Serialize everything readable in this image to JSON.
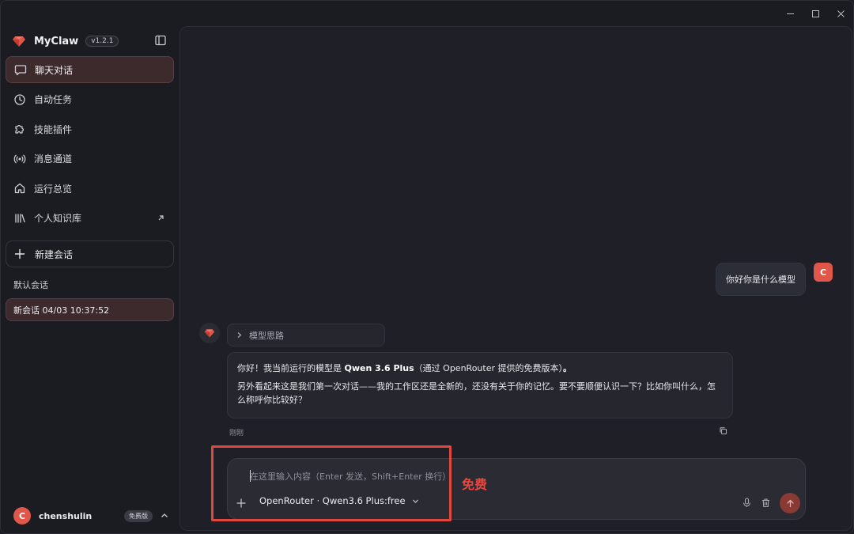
{
  "window": {
    "controls": [
      "minimize",
      "maximize",
      "close"
    ]
  },
  "sidebar": {
    "brand": {
      "name": "MyClaw",
      "version": "v1.2.1"
    },
    "nav": [
      {
        "label": "聊天对话",
        "icon": "chat-bubble-icon",
        "active": true
      },
      {
        "label": "自动任务",
        "icon": "clock-icon",
        "active": false
      },
      {
        "label": "技能插件",
        "icon": "puzzle-icon",
        "active": false
      },
      {
        "label": "消息通道",
        "icon": "broadcast-icon",
        "active": false
      },
      {
        "label": "运行总览",
        "icon": "home-icon",
        "active": false
      },
      {
        "label": "个人知识库",
        "icon": "library-icon",
        "active": false,
        "external": true
      }
    ],
    "new_chat_label": "新建会话",
    "group_label": "默认会话",
    "sessions": [
      {
        "title": "新会话 04/03 10:37:52",
        "active": true
      }
    ],
    "user": {
      "initial": "C",
      "name": "chenshulin",
      "plan": "免费版"
    }
  },
  "chat": {
    "user_message": {
      "text": "你好你是什么模型",
      "initial": "C"
    },
    "bot": {
      "thinking_label": "模型思路",
      "reply_line1_pre": "你好！我当前运行的模型是 ",
      "reply_line1_bold": "Qwen 3.6 Plus",
      "reply_line1_post": "（通过 OpenRouter 提供的免费版本）",
      "reply_line1_end": "。",
      "reply_line2": "另外看起来这是我们第一次对话——我的工作区还是全新的，还没有关于你的记忆。要不要顺便认识一下？比如你叫什么，怎么称呼你比较好？",
      "timestamp": "刚刚"
    }
  },
  "composer": {
    "value": "",
    "placeholder": "在这里输入内容（Enter 发送，Shift+Enter 换行）",
    "model": "OpenRouter · Qwen3.6 Plus:free"
  },
  "annotation": {
    "text": "免费",
    "color": "#e0473f"
  },
  "colors": {
    "accent": "#e0574a",
    "active_bg": "#3d2a2c",
    "send_button": "#8a3a34"
  }
}
